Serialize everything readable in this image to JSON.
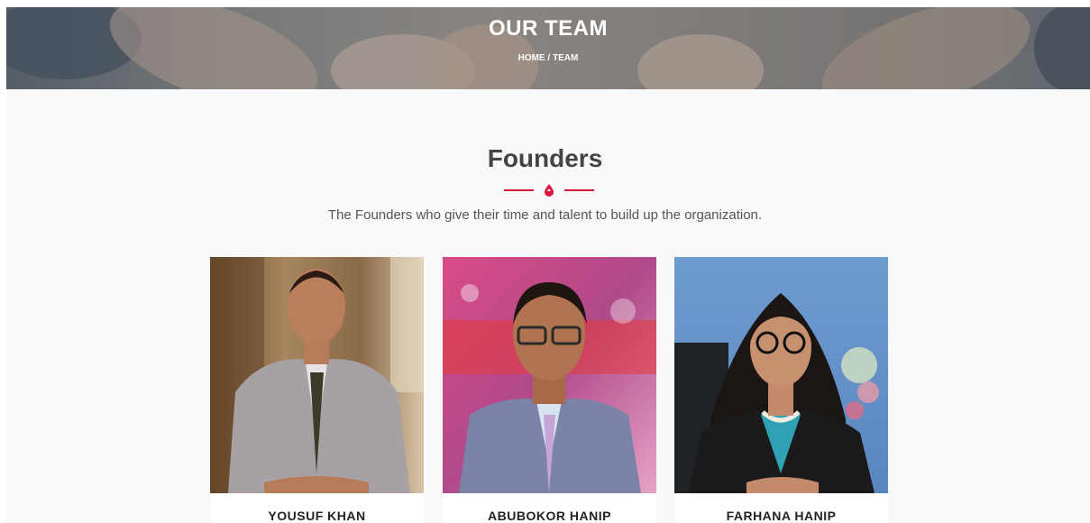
{
  "hero": {
    "title": "OUR TEAM",
    "breadcrumb": {
      "home": "HOME",
      "separator": " / ",
      "current": "TEAM"
    }
  },
  "section": {
    "title": "Founders",
    "subtitle": "The Founders who give their time and talent to build up the organization."
  },
  "colors": {
    "accent": "#dc143c",
    "heading": "#444444",
    "background": "#f8f9fb"
  },
  "team": [
    {
      "name": "YOUSUF KHAN"
    },
    {
      "name": "ABUBOKOR HANIP"
    },
    {
      "name": "FARHANA HANIP"
    }
  ]
}
